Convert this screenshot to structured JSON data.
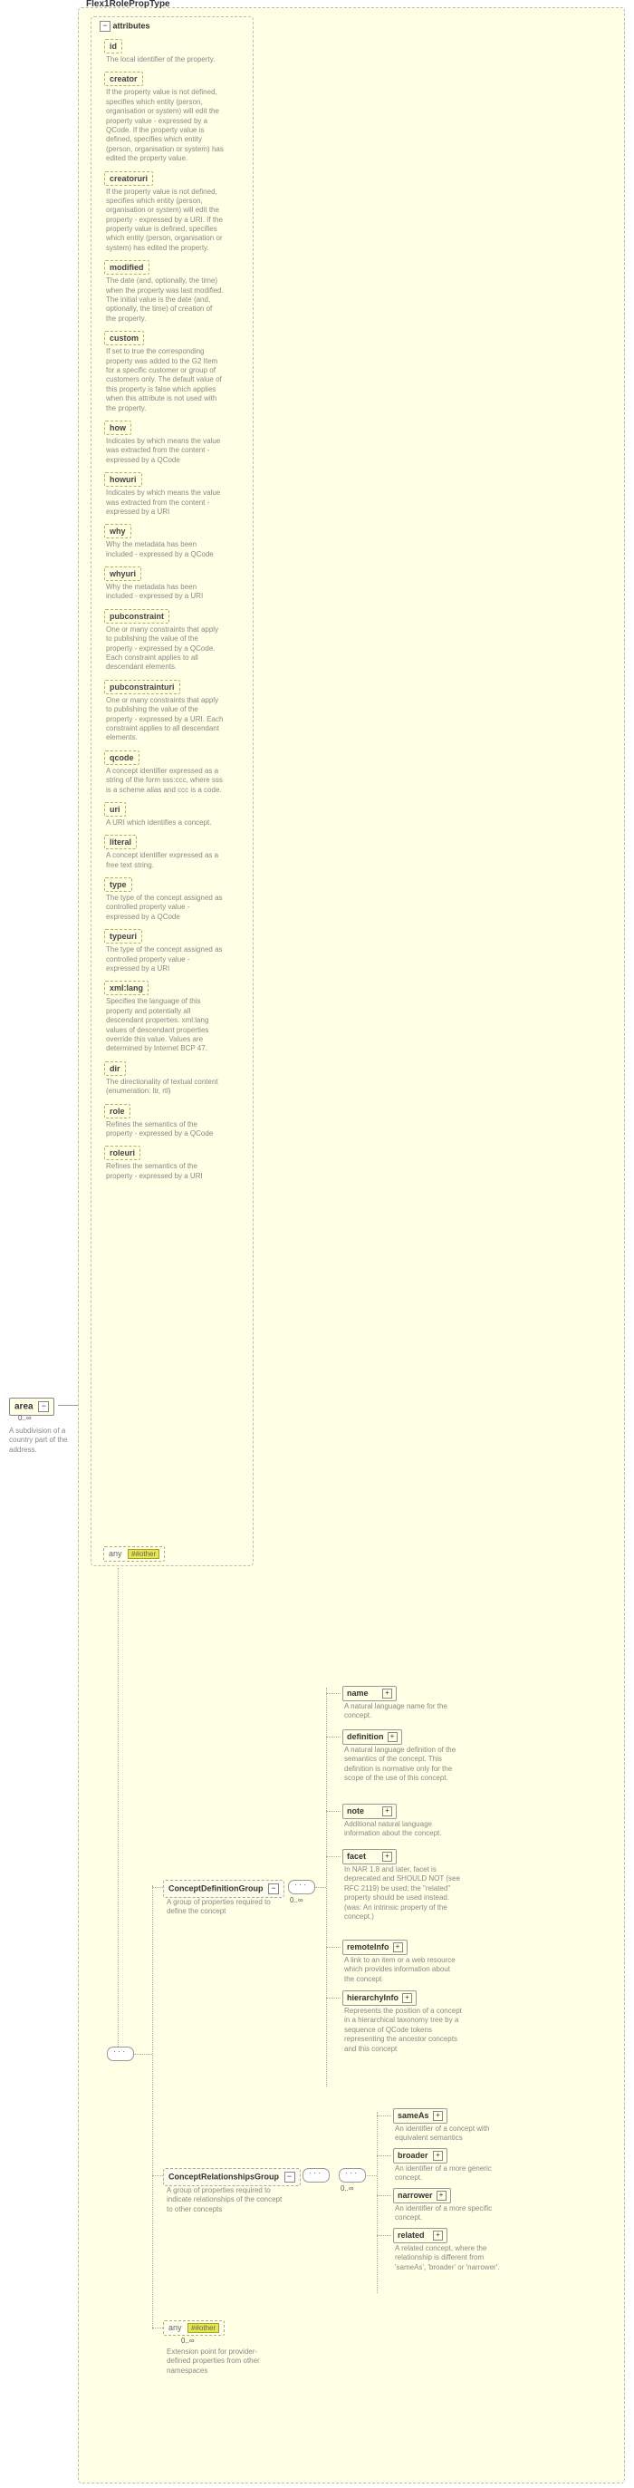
{
  "root": {
    "type_name": "Flex1RolePropType",
    "element": "area",
    "element_card": "0..∞",
    "element_desc": "A subdivision of a country part of the address."
  },
  "attributes_label": "attributes",
  "attributes": [
    {
      "name": "id",
      "desc": "The local identifier of the property."
    },
    {
      "name": "creator",
      "desc": "If the property value is not defined, specifies which entity (person, organisation or system) will edit the property value - expressed by a QCode. If the property value is defined, specifies which entity (person, organisation or system) has edited the property value."
    },
    {
      "name": "creatoruri",
      "desc": "If the property value is not defined, specifies which entity (person, organisation or system) will edit the property - expressed by a URI. If the property value is defined, specifies which entity (person, organisation or system) has edited the property."
    },
    {
      "name": "modified",
      "desc": "The date (and, optionally, the time) when the property was last modified. The initial value is the date (and, optionally, the time) of creation of the property."
    },
    {
      "name": "custom",
      "desc": "If set to true the corresponding property was added to the G2 Item for a specific customer or group of customers only. The default value of this property is false which applies when this attribute is not used with the property."
    },
    {
      "name": "how",
      "desc": "Indicates by which means the value was extracted from the content - expressed by a QCode"
    },
    {
      "name": "howuri",
      "desc": "Indicates by which means the value was extracted from the content - expressed by a URI"
    },
    {
      "name": "why",
      "desc": "Why the metadata has been included - expressed by a QCode"
    },
    {
      "name": "whyuri",
      "desc": "Why the metadata has been included - expressed by a URI"
    },
    {
      "name": "pubconstraint",
      "desc": "One or many constraints that apply to publishing the value of the property - expressed by a QCode. Each constraint applies to all descendant elements."
    },
    {
      "name": "pubconstrainturi",
      "desc": "One or many constraints that apply to publishing the value of the property - expressed by a URI. Each constraint applies to all descendant elements."
    },
    {
      "name": "qcode",
      "desc": "A concept identifier expressed as a string of the form sss:ccc, where sss is a scheme alias and ccc is a code."
    },
    {
      "name": "uri",
      "desc": "A URI which identifies a concept."
    },
    {
      "name": "literal",
      "desc": "A concept identifier expressed as a free text string."
    },
    {
      "name": "type",
      "desc": "The type of the concept assigned as controlled property value - expressed by a QCode"
    },
    {
      "name": "typeuri",
      "desc": "The type of the concept assigned as controlled property value - expressed by a URI"
    },
    {
      "name": "xml:lang",
      "desc": "Specifies the language of this property and potentially all descendant properties. xml:lang values of descendant properties override this value. Values are determined by Internet BCP 47."
    },
    {
      "name": "dir",
      "desc": "The directionality of textual content (enumeration: ltr, rtl)"
    },
    {
      "name": "role",
      "desc": "Refines the semantics of the property - expressed by a QCode"
    },
    {
      "name": "roleuri",
      "desc": "Refines the semantics of the property - expressed by a URI"
    }
  ],
  "any_attr": {
    "label": "any",
    "ns": "##other"
  },
  "groups": {
    "cdef": {
      "name": "ConceptDefinitionGroup",
      "card": "0..∞",
      "desc": "A group of properties required to define the concept"
    },
    "crel": {
      "name": "ConceptRelationshipsGroup",
      "card": "0..∞",
      "desc": "A group of properties required to indicate relationships of the concept to other concepts"
    },
    "any_el": {
      "label": "any",
      "ns": "##other",
      "card": "0..∞",
      "desc": "Extension point for provider-defined properties from other namespaces"
    }
  },
  "cdef_children": [
    {
      "name": "name",
      "desc": "A natural language name for the concept."
    },
    {
      "name": "definition",
      "desc": "A natural language definition of the semantics of the concept. This definition is normative only for the scope of the use of this concept."
    },
    {
      "name": "note",
      "desc": "Additional natural language information about the concept."
    },
    {
      "name": "facet",
      "desc": "In NAR 1.8 and later, facet is deprecated and SHOULD NOT (see RFC 2119) be used; the \"related\" property should be used instead. (was: An intrinsic property of the concept.)"
    },
    {
      "name": "remoteInfo",
      "desc": "A link to an item or a web resource which provides information about the concept"
    },
    {
      "name": "hierarchyInfo",
      "desc": "Represents the position of a concept in a hierarchical taxonomy tree by a sequence of QCode tokens representing the ancestor concepts and this concept"
    }
  ],
  "crel_children": [
    {
      "name": "sameAs",
      "desc": "An identifier of a concept with equivalent semantics"
    },
    {
      "name": "broader",
      "desc": "An identifier of a more generic concept."
    },
    {
      "name": "narrower",
      "desc": "An identifier of a more specific concept."
    },
    {
      "name": "related",
      "desc": "A related concept, where the relationship is different from 'sameAs', 'broader' or 'narrower'."
    }
  ]
}
